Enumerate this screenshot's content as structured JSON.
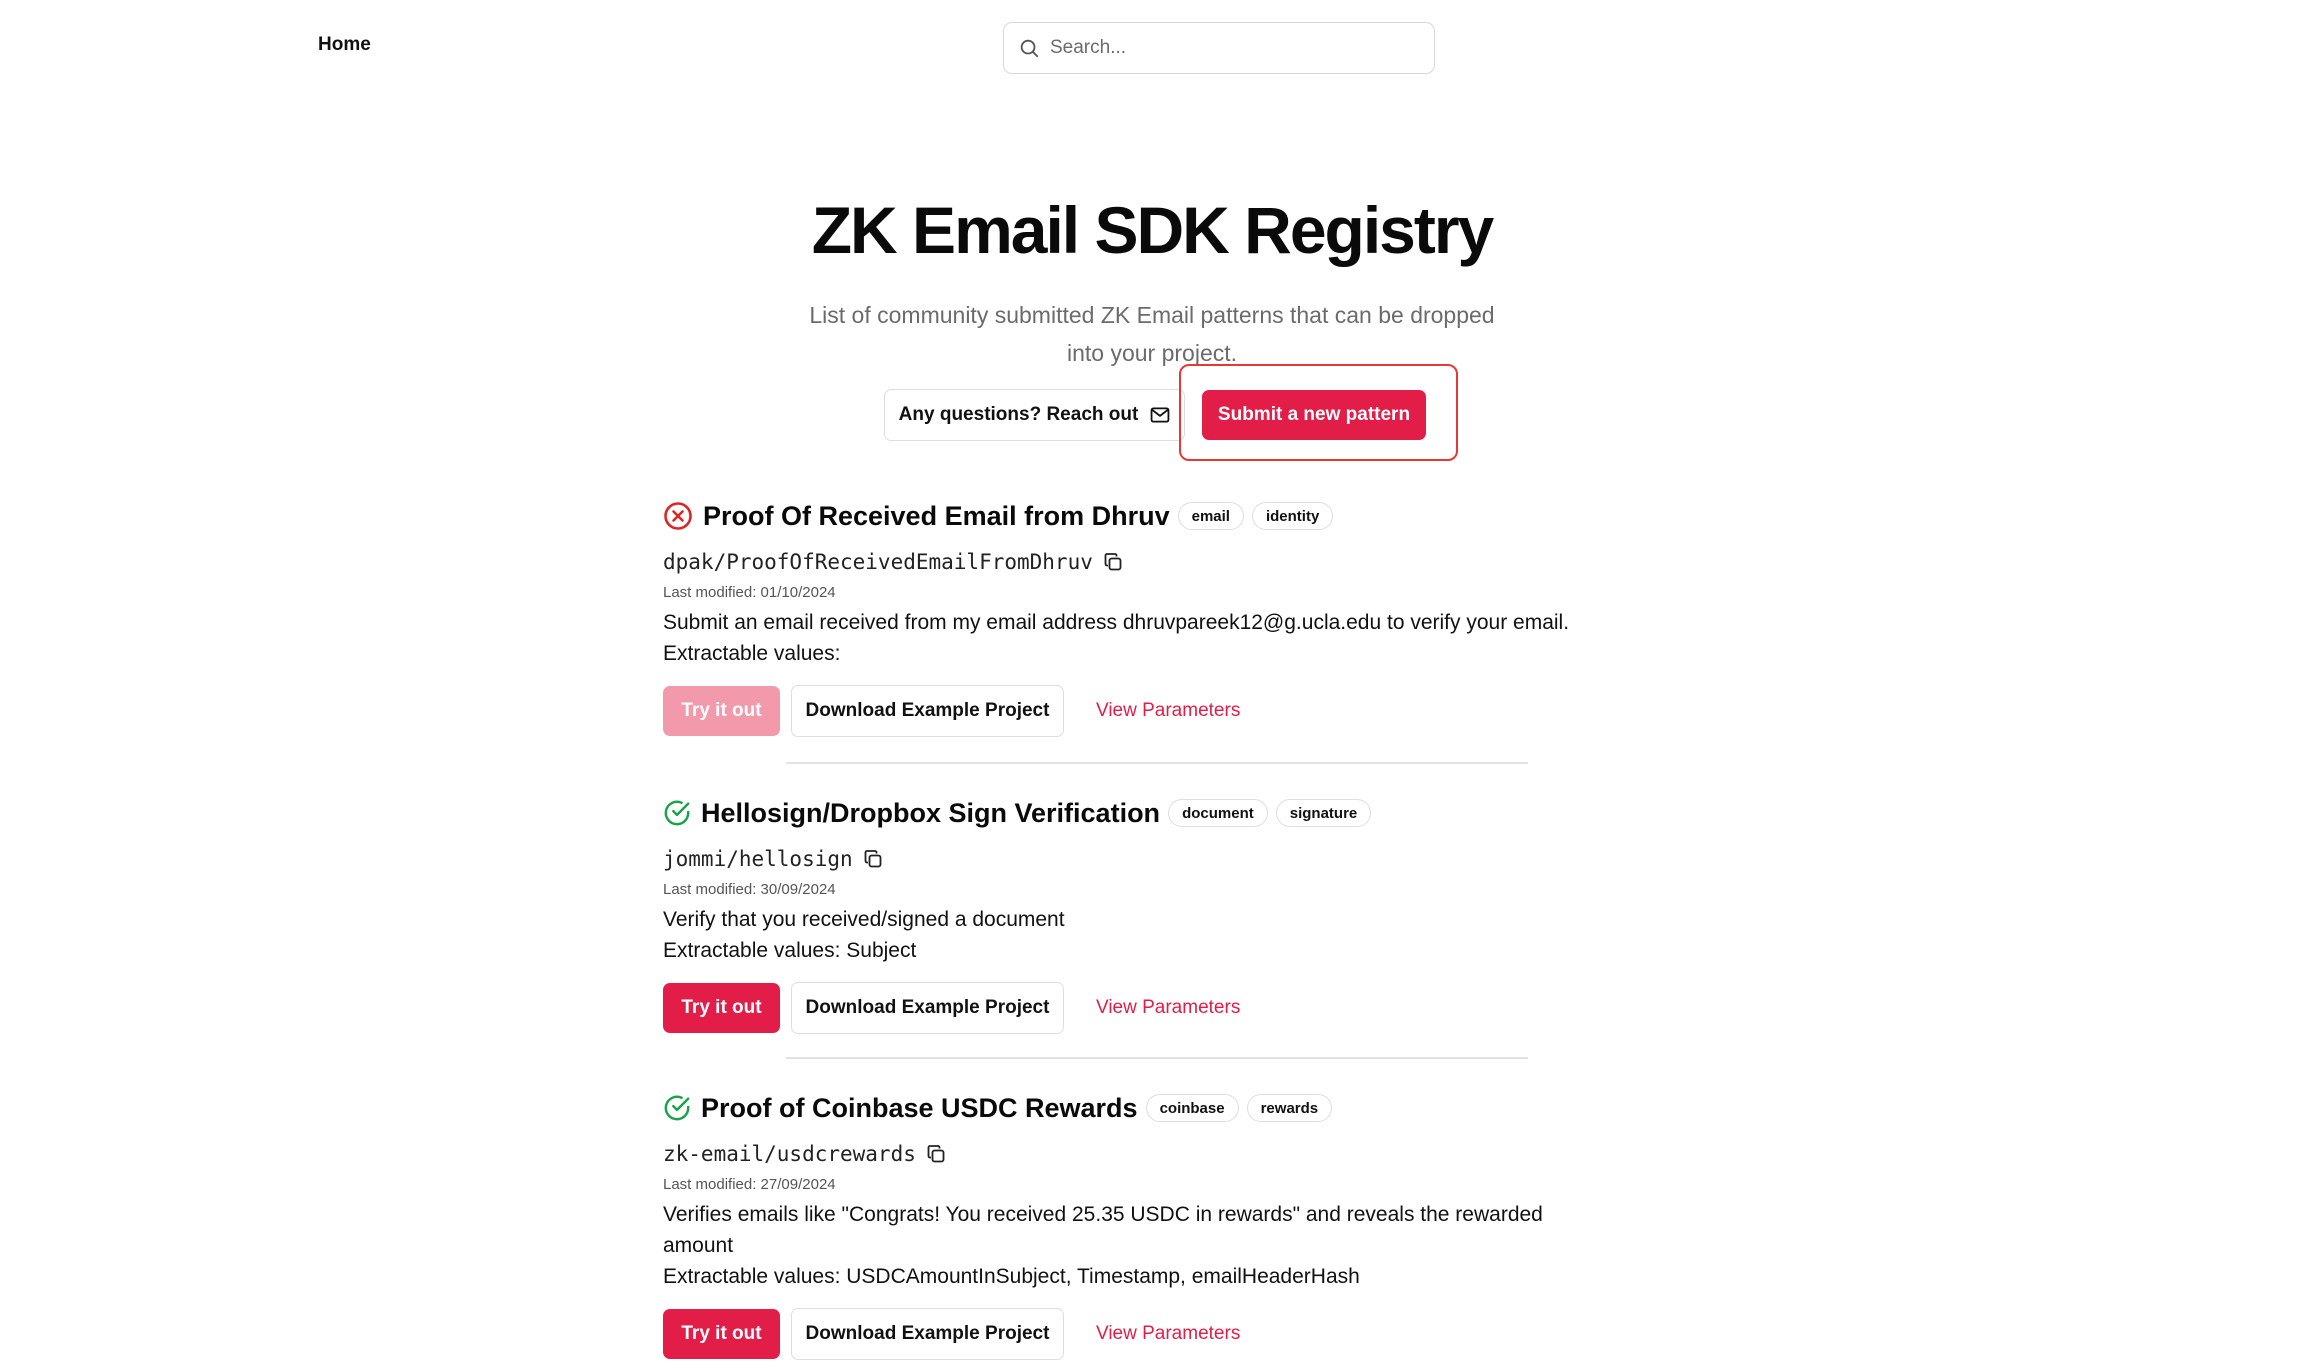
{
  "nav": {
    "home_label": "Home"
  },
  "search": {
    "placeholder": "Search..."
  },
  "hero": {
    "title": "ZK Email SDK Registry",
    "subtitle": "List of community submitted ZK Email patterns that can be dropped into your project.",
    "reach_out_label": "Any questions? Reach out",
    "submit_label": "Submit a new pattern"
  },
  "colors": {
    "accent": "#e11d48",
    "success": "#16a34a",
    "error": "#dc2626",
    "highlight": "#e53935"
  },
  "patterns": [
    {
      "status": "failed",
      "status_icon": "x-circle-icon",
      "title": "Proof Of Received Email from Dhruv",
      "tags": [
        "email",
        "identity"
      ],
      "slug": "dpak/ProofOfReceivedEmailFromDhruv",
      "last_modified": "Last modified: 01/10/2024",
      "description": "Submit an email received from my email address dhruvpareek12@g.ucla.edu to verify your email.",
      "extractable": "Extractable values:",
      "try_label": "Try it out",
      "download_label": "Download Example Project",
      "params_label": "View Parameters"
    },
    {
      "status": "verified",
      "status_icon": "check-circle-icon",
      "title": "Hellosign/Dropbox Sign Verification",
      "tags": [
        "document",
        "signature"
      ],
      "slug": "jommi/hellosign",
      "last_modified": "Last modified: 30/09/2024",
      "description": "Verify that you received/signed a document",
      "extractable": "Extractable values: Subject",
      "try_label": "Try it out",
      "download_label": "Download Example Project",
      "params_label": "View Parameters"
    },
    {
      "status": "verified",
      "status_icon": "check-circle-icon",
      "title": "Proof of Coinbase USDC Rewards",
      "tags": [
        "coinbase",
        "rewards"
      ],
      "slug": "zk-email/usdcrewards",
      "last_modified": "Last modified: 27/09/2024",
      "description": "Verifies emails like \"Congrats! You received 25.35 USDC in rewards\" and reveals the rewarded amount",
      "extractable": "Extractable values: USDCAmountInSubject, Timestamp, emailHeaderHash",
      "try_label": "Try it out",
      "download_label": "Download Example Project",
      "params_label": "View Parameters"
    }
  ]
}
